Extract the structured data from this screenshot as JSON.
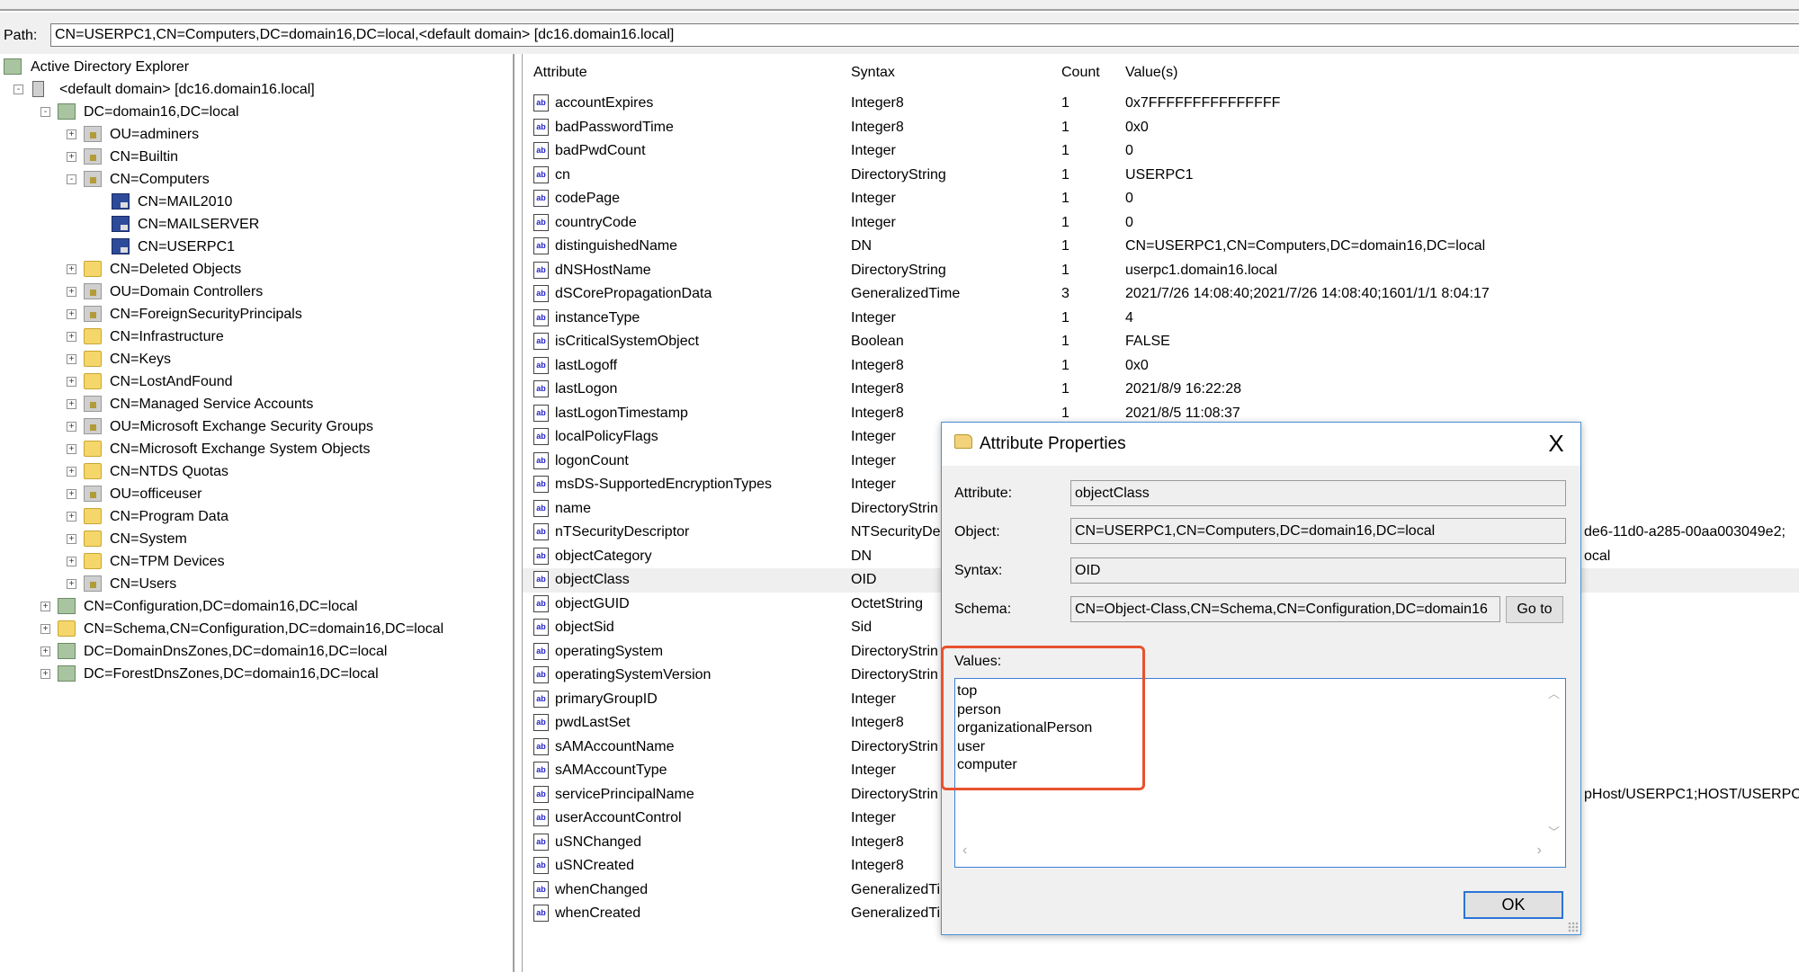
{
  "path": {
    "label": "Path:",
    "value": "CN=USERPC1,CN=Computers,DC=domain16,DC=local,<default domain> [dc16.domain16.local]"
  },
  "tree": [
    {
      "label": "Active Directory Explorer",
      "level": 0,
      "icon": "ad-explorer-icon",
      "exp": ""
    },
    {
      "label": "<default domain> [dc16.domain16.local]",
      "level": 1,
      "icon": "server-icon",
      "exp": "-"
    },
    {
      "label": "DC=domain16,DC=local",
      "level": 2,
      "icon": "domain-icon",
      "exp": "-"
    },
    {
      "label": "OU=adminers",
      "level": 3,
      "icon": "ou-icon",
      "exp": "+"
    },
    {
      "label": "CN=Builtin",
      "level": 3,
      "icon": "container-icon",
      "exp": "+"
    },
    {
      "label": "CN=Computers",
      "level": 3,
      "icon": "container-icon",
      "exp": "-"
    },
    {
      "label": "CN=MAIL2010",
      "level": 4,
      "icon": "computer-icon",
      "exp": ""
    },
    {
      "label": "CN=MAILSERVER",
      "level": 4,
      "icon": "computer-icon",
      "exp": ""
    },
    {
      "label": "CN=USERPC1",
      "level": 4,
      "icon": "computer-icon",
      "exp": ""
    },
    {
      "label": "CN=Deleted Objects",
      "level": 3,
      "icon": "folder-icon",
      "exp": "+"
    },
    {
      "label": "OU=Domain Controllers",
      "level": 3,
      "icon": "ou-icon",
      "exp": "+"
    },
    {
      "label": "CN=ForeignSecurityPrincipals",
      "level": 3,
      "icon": "container-icon",
      "exp": "+"
    },
    {
      "label": "CN=Infrastructure",
      "level": 3,
      "icon": "folder-icon",
      "exp": "+"
    },
    {
      "label": "CN=Keys",
      "level": 3,
      "icon": "folder-icon",
      "exp": "+"
    },
    {
      "label": "CN=LostAndFound",
      "level": 3,
      "icon": "folder-icon",
      "exp": "+"
    },
    {
      "label": "CN=Managed Service Accounts",
      "level": 3,
      "icon": "container-icon",
      "exp": "+"
    },
    {
      "label": "OU=Microsoft Exchange Security Groups",
      "level": 3,
      "icon": "ou-icon",
      "exp": "+"
    },
    {
      "label": "CN=Microsoft Exchange System Objects",
      "level": 3,
      "icon": "folder-icon",
      "exp": "+"
    },
    {
      "label": "CN=NTDS Quotas",
      "level": 3,
      "icon": "folder-icon",
      "exp": "+"
    },
    {
      "label": "OU=officeuser",
      "level": 3,
      "icon": "ou-icon",
      "exp": "+"
    },
    {
      "label": "CN=Program Data",
      "level": 3,
      "icon": "folder-icon",
      "exp": "+"
    },
    {
      "label": "CN=System",
      "level": 3,
      "icon": "folder-icon",
      "exp": "+"
    },
    {
      "label": "CN=TPM Devices",
      "level": 3,
      "icon": "folder-icon",
      "exp": "+"
    },
    {
      "label": "CN=Users",
      "level": 3,
      "icon": "container-icon",
      "exp": "+"
    },
    {
      "label": "CN=Configuration,DC=domain16,DC=local",
      "level": 2,
      "icon": "config-icon",
      "exp": "+"
    },
    {
      "label": "CN=Schema,CN=Configuration,DC=domain16,DC=local",
      "level": 2,
      "icon": "folder-icon",
      "exp": "+"
    },
    {
      "label": "DC=DomainDnsZones,DC=domain16,DC=local",
      "level": 2,
      "icon": "domain-icon",
      "exp": "+"
    },
    {
      "label": "DC=ForestDnsZones,DC=domain16,DC=local",
      "level": 2,
      "icon": "domain-icon",
      "exp": "+"
    }
  ],
  "list": {
    "headers": [
      "Attribute",
      "Syntax",
      "Count",
      "Value(s)"
    ],
    "selected": "objectClass",
    "rows": [
      {
        "a": "accountExpires",
        "s": "Integer8",
        "c": "1",
        "v": "0x7FFFFFFFFFFFFFFF"
      },
      {
        "a": "badPasswordTime",
        "s": "Integer8",
        "c": "1",
        "v": "0x0"
      },
      {
        "a": "badPwdCount",
        "s": "Integer",
        "c": "1",
        "v": "0"
      },
      {
        "a": "cn",
        "s": "DirectoryString",
        "c": "1",
        "v": "USERPC1"
      },
      {
        "a": "codePage",
        "s": "Integer",
        "c": "1",
        "v": "0"
      },
      {
        "a": "countryCode",
        "s": "Integer",
        "c": "1",
        "v": "0"
      },
      {
        "a": "distinguishedName",
        "s": "DN",
        "c": "1",
        "v": "CN=USERPC1,CN=Computers,DC=domain16,DC=local"
      },
      {
        "a": "dNSHostName",
        "s": "DirectoryString",
        "c": "1",
        "v": "userpc1.domain16.local"
      },
      {
        "a": "dSCorePropagationData",
        "s": "GeneralizedTime",
        "c": "3",
        "v": "2021/7/26 14:08:40;2021/7/26 14:08:40;1601/1/1 8:04:17"
      },
      {
        "a": "instanceType",
        "s": "Integer",
        "c": "1",
        "v": "4"
      },
      {
        "a": "isCriticalSystemObject",
        "s": "Boolean",
        "c": "1",
        "v": "FALSE"
      },
      {
        "a": "lastLogoff",
        "s": "Integer8",
        "c": "1",
        "v": "0x0"
      },
      {
        "a": "lastLogon",
        "s": "Integer8",
        "c": "1",
        "v": "2021/8/9 16:22:28"
      },
      {
        "a": "lastLogonTimestamp",
        "s": "Integer8",
        "c": "1",
        "v": "2021/8/5 11:08:37"
      },
      {
        "a": "localPolicyFlags",
        "s": "Integer",
        "c": "",
        "v": ""
      },
      {
        "a": "logonCount",
        "s": "Integer",
        "c": "",
        "v": ""
      },
      {
        "a": "msDS-SupportedEncryptionTypes",
        "s": "Integer",
        "c": "",
        "v": ""
      },
      {
        "a": "name",
        "s": "DirectoryStrin",
        "c": "",
        "v": ""
      },
      {
        "a": "nTSecurityDescriptor",
        "s": "NTSecurityDe",
        "c": "",
        "v": "",
        "frag": "de6-11d0-a285-00aa003049e2;"
      },
      {
        "a": "objectCategory",
        "s": "DN",
        "c": "",
        "v": "",
        "frag": "ocal"
      },
      {
        "a": "objectClass",
        "s": "OID",
        "c": "",
        "v": ""
      },
      {
        "a": "objectGUID",
        "s": "OctetString",
        "c": "",
        "v": ""
      },
      {
        "a": "objectSid",
        "s": "Sid",
        "c": "",
        "v": ""
      },
      {
        "a": "operatingSystem",
        "s": "DirectoryStrin",
        "c": "",
        "v": ""
      },
      {
        "a": "operatingSystemVersion",
        "s": "DirectoryStrin",
        "c": "",
        "v": ""
      },
      {
        "a": "primaryGroupID",
        "s": "Integer",
        "c": "",
        "v": ""
      },
      {
        "a": "pwdLastSet",
        "s": "Integer8",
        "c": "",
        "v": ""
      },
      {
        "a": "sAMAccountName",
        "s": "DirectoryStrin",
        "c": "",
        "v": ""
      },
      {
        "a": "sAMAccountType",
        "s": "Integer",
        "c": "",
        "v": ""
      },
      {
        "a": "servicePrincipalName",
        "s": "DirectoryStrin",
        "c": "",
        "v": "",
        "frag": "pHost/USERPC1;HOST/USERPC1"
      },
      {
        "a": "userAccountControl",
        "s": "Integer",
        "c": "",
        "v": ""
      },
      {
        "a": "uSNChanged",
        "s": "Integer8",
        "c": "",
        "v": ""
      },
      {
        "a": "uSNCreated",
        "s": "Integer8",
        "c": "",
        "v": ""
      },
      {
        "a": "whenChanged",
        "s": "GeneralizedTi",
        "c": "",
        "v": ""
      },
      {
        "a": "whenCreated",
        "s": "GeneralizedTi",
        "c": "",
        "v": ""
      }
    ]
  },
  "dialog": {
    "title": "Attribute Properties",
    "close": "X",
    "attribute_label": "Attribute:",
    "attribute_value": "objectClass",
    "object_label": "Object:",
    "object_value": "CN=USERPC1,CN=Computers,DC=domain16,DC=local",
    "syntax_label": "Syntax:",
    "syntax_value": "OID",
    "schema_label": "Schema:",
    "schema_value": "CN=Object-Class,CN=Schema,CN=Configuration,DC=domain16",
    "goto_label": "Go to",
    "values_label": "Values:",
    "values": [
      "top",
      "person",
      "organizationalPerson",
      "user",
      "computer"
    ],
    "ok_label": "OK",
    "highlight_color": "#e8522f"
  }
}
